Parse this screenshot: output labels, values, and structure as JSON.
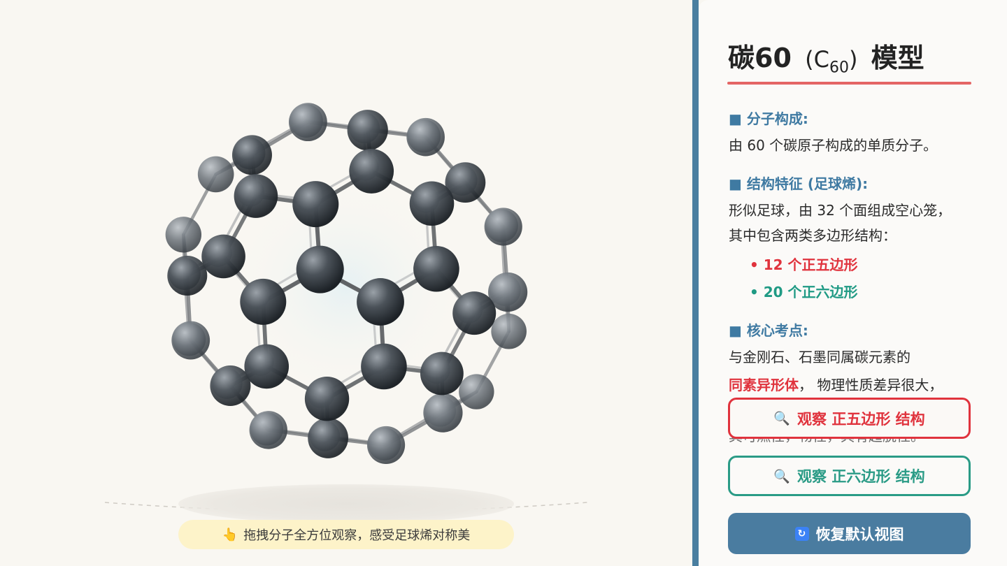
{
  "viewer": {
    "hint_text": "拖拽分子全方位观察，感受足球烯对称美",
    "hint_icon": "pointing-hand-icon"
  },
  "panel": {
    "title_main": "碳60",
    "title_formula_open": "(C",
    "title_formula_sub": "60",
    "title_formula_close": ")",
    "title_suffix": "模型",
    "section1_heading": "■ 分子构成:",
    "section1_text": "由 60 个碳原子构成的单质分子。",
    "section2_heading": "■ 结构特征 (足球烯):",
    "section2_line1": "形似足球，由 32 个面组成空心笼，",
    "section2_line2": "其中包含两类多边形结构：",
    "bullet_pentagon": "• 12 个正五边形",
    "bullet_hexagon": "• 20 个正六边形",
    "section3_heading": "■ 核心考点:",
    "section3_line1": "与金刚石、石墨同属碳元素的",
    "section3_highlight": "同素异形体",
    "section3_line2_rest": "， 物理性质差异很大，",
    "section3_line3_partial": "其可燃性，物性，具有超脱性。",
    "btn_pentagon_label": "观察 正五边形 结构",
    "btn_hexagon_label": "观察 正六边形 结构",
    "btn_reset_label": "恢复默认视图",
    "btn_icon": "magnifier-icon",
    "reset_icon": "refresh-icon"
  },
  "colors": {
    "accent_blue": "#4a7fa0",
    "pentagon_red": "#e0333d",
    "hexagon_green": "#2a9b86",
    "title_underline": "#e46565",
    "hint_bg": "#fdf3c9"
  }
}
